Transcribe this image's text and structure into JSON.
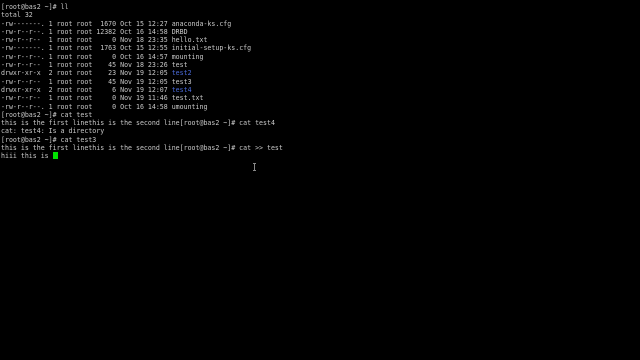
{
  "terminal": {
    "lines": [
      {
        "text": "[root@bas2 ~]# ll"
      },
      {
        "text": "total 32"
      },
      {
        "prefix": "-rw-------. 1 root root  1670 Oct 15 12:27 ",
        "name": "anaconda-ks.cfg",
        "dir": false
      },
      {
        "prefix": "-rw-r--r--. 1 root root 12382 Oct 16 14:58 ",
        "name": "DRBD",
        "dir": false
      },
      {
        "prefix": "-rw-r--r--  1 root root     0 Nov 18 23:35 ",
        "name": "hello.txt",
        "dir": false
      },
      {
        "prefix": "-rw-------. 1 root root  1763 Oct 15 12:55 ",
        "name": "initial-setup-ks.cfg",
        "dir": false
      },
      {
        "prefix": "-rw-r--r--. 1 root root     0 Oct 16 14:57 ",
        "name": "mounting",
        "dir": false
      },
      {
        "prefix": "-rw-r--r--  1 root root    45 Nov 18 23:26 ",
        "name": "test",
        "dir": false
      },
      {
        "prefix": "drwxr-xr-x  2 root root    23 Nov 19 12:05 ",
        "name": "test2",
        "dir": true
      },
      {
        "prefix": "-rw-r--r--  1 root root    45 Nov 19 12:05 ",
        "name": "test3",
        "dir": false
      },
      {
        "prefix": "drwxr-xr-x  2 root root     6 Nov 19 12:07 ",
        "name": "test4",
        "dir": true
      },
      {
        "prefix": "-rw-r--r--  1 root root     0 Nov 19 11:46 ",
        "name": "test.txt",
        "dir": false
      },
      {
        "prefix": "-rw-r--r--. 1 root root     0 Oct 16 14:58 ",
        "name": "umounting",
        "dir": false
      },
      {
        "text": "[root@bas2 ~]# cat test"
      },
      {
        "text": "this is the first linethis is the second line[root@bas2 ~]# cat test4"
      },
      {
        "text": "cat: test4: Is a directory"
      },
      {
        "text": "[root@bas2 ~]# cat test3"
      },
      {
        "text": "this is the first linethis is the second line[root@bas2 ~]# cat >> test"
      },
      {
        "text": "hiii this is ",
        "cursor": true
      }
    ],
    "colors": {
      "background": "#000000",
      "foreground": "#c8c8c8",
      "directory": "#4a6ad8",
      "cursor": "#00e000"
    }
  }
}
